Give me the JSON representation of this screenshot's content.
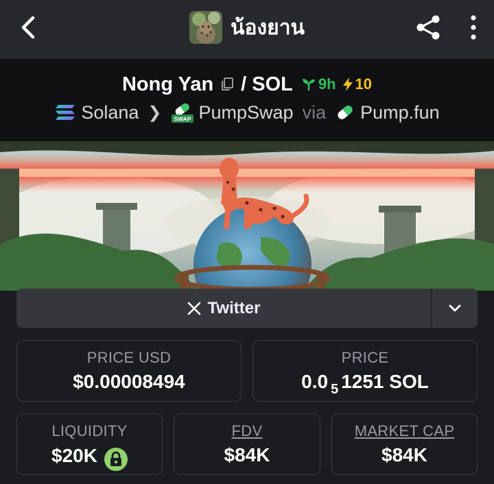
{
  "header": {
    "title": "น้องยาน",
    "back_icon": "chevron-left-icon",
    "share_icon": "share-icon",
    "more_icon": "more-vertical-icon"
  },
  "pair": {
    "base": "Nong Yan",
    "separator": "/",
    "quote": "SOL",
    "age": "9h",
    "boosts": "10",
    "chain": "Solana",
    "dex": "PumpSwap",
    "dex_badge": "SWAP",
    "via": "via",
    "launchpad": "Pump.fun",
    "colors": {
      "age": "#2fbf5a",
      "boost": "#f4c21d"
    }
  },
  "links": {
    "twitter_label": "Twitter",
    "twitter_icon": "x-logo-icon",
    "dropdown_icon": "chevron-down-icon"
  },
  "stats": {
    "price_usd": {
      "label": "PRICE USD",
      "value": "$0.00008494"
    },
    "price_native": {
      "label": "PRICE",
      "value_prefix": "0.0",
      "value_subscript": "5",
      "value_suffix": "1251 SOL"
    },
    "liquidity": {
      "label": "LIQUIDITY",
      "value": "$20K",
      "lock_icon": "lock-icon"
    },
    "fdv": {
      "label": "FDV",
      "value": "$84K"
    },
    "market_cap": {
      "label": "MARKET CAP",
      "value": "$84K"
    }
  }
}
